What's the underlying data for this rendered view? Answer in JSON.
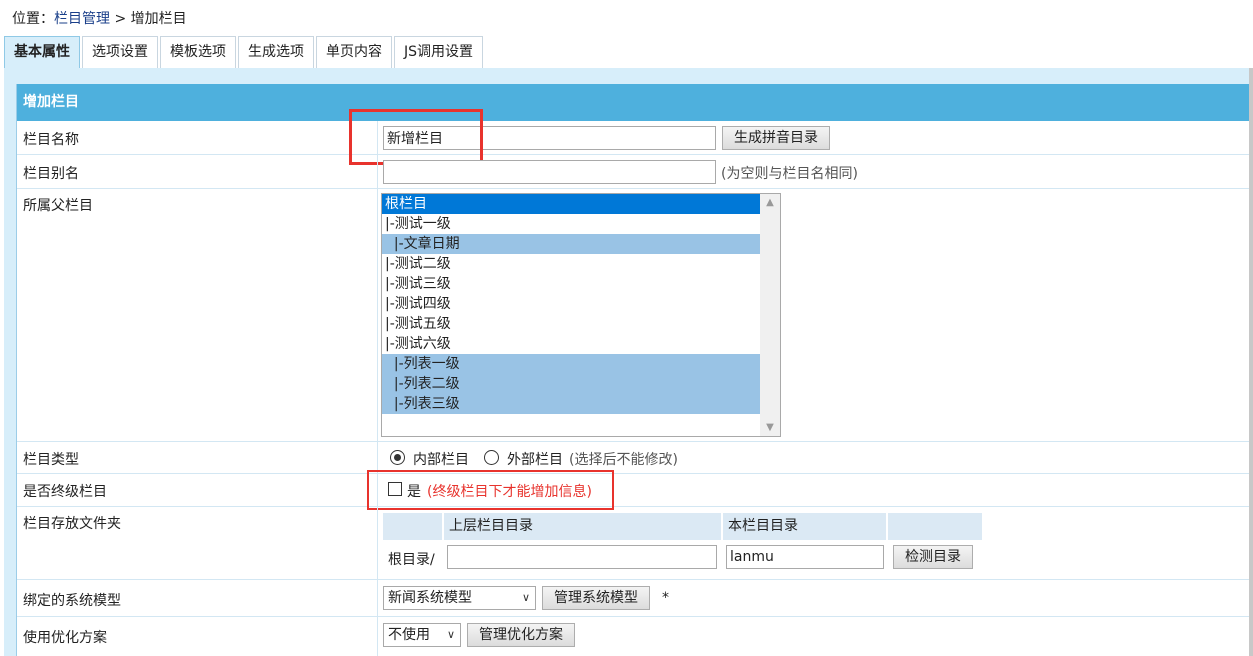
{
  "breadcrumb": {
    "prefix": "位置：",
    "section": "栏目管理",
    "sep": " > ",
    "current": "增加栏目"
  },
  "tabs": [
    {
      "label": "基本属性",
      "active": true
    },
    {
      "label": "选项设置"
    },
    {
      "label": "模板选项"
    },
    {
      "label": "生成选项"
    },
    {
      "label": "单页内容"
    },
    {
      "label": "JS调用设置"
    }
  ],
  "panel": {
    "title": "增加栏目"
  },
  "form": {
    "name": {
      "label": "栏目名称",
      "value": "新增栏目",
      "button": "生成拼音目录"
    },
    "alias": {
      "label": "栏目别名",
      "value": "",
      "hint": "(为空则与栏目名相同)"
    },
    "parent": {
      "label": "所属父栏目",
      "options": [
        {
          "text": "根栏目",
          "state": "selected"
        },
        {
          "text": "|-测试一级",
          "state": ""
        },
        {
          "text": "  |-文章日期",
          "state": "highlight"
        },
        {
          "text": "|-测试二级",
          "state": ""
        },
        {
          "text": "|-测试三级",
          "state": ""
        },
        {
          "text": "|-测试四级",
          "state": ""
        },
        {
          "text": "|-测试五级",
          "state": ""
        },
        {
          "text": "|-测试六级",
          "state": ""
        },
        {
          "text": "  |-列表一级",
          "state": "highlight"
        },
        {
          "text": "  |-列表二级",
          "state": "highlight"
        },
        {
          "text": "  |-列表三级",
          "state": "highlight"
        }
      ]
    },
    "type": {
      "label": "栏目类型",
      "option_internal": "内部栏目",
      "option_external": "外部栏目",
      "hint": "(选择后不能修改)",
      "selected": "internal"
    },
    "final": {
      "label": "是否终级栏目",
      "checkbox_label": "是",
      "note": "(终级栏目下才能增加信息)",
      "checked": false
    },
    "folder": {
      "label": "栏目存放文件夹",
      "col_parent": "上层栏目目录",
      "col_self": "本栏目目录",
      "root_prefix": "根目录/",
      "parent_value": "",
      "self_value": "lanmu",
      "button": "检测目录"
    },
    "model": {
      "label": "绑定的系统模型",
      "selected": "新闻系统模型",
      "button": "管理系统模型",
      "required_mark": "*"
    },
    "optimize": {
      "label": "使用优化方案",
      "selected": "不使用",
      "button": "管理优化方案"
    }
  }
}
